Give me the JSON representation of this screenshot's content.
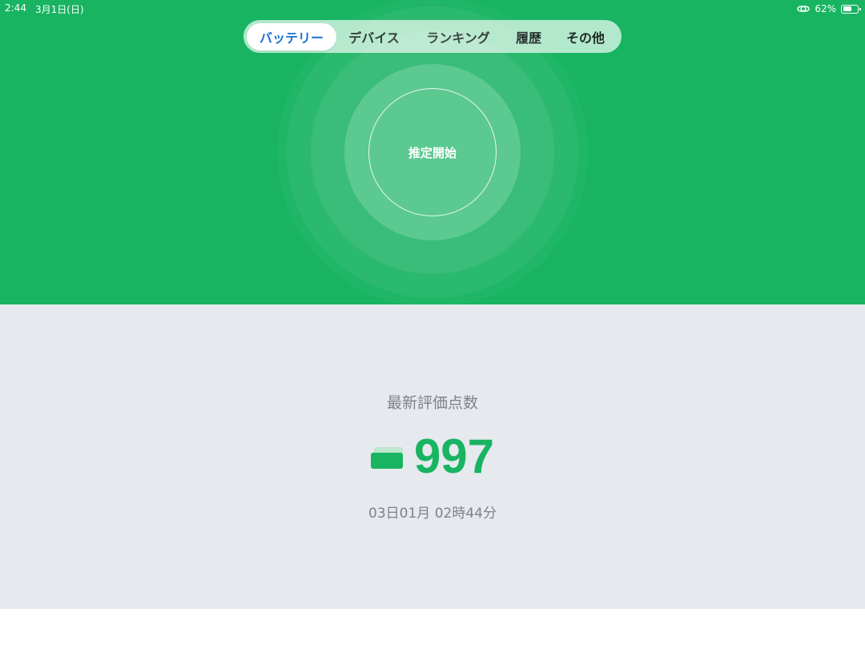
{
  "status_bar": {
    "time": "2:44",
    "date": "3月1日(日)",
    "battery_percent": "62%",
    "battery_level": 0.62
  },
  "tabs": [
    {
      "label": "バッテリー",
      "active": true
    },
    {
      "label": "デバイス",
      "active": false
    },
    {
      "label": "ランキング",
      "active": false
    },
    {
      "label": "履歴",
      "active": false
    },
    {
      "label": "その他",
      "active": false
    }
  ],
  "hero": {
    "start_label": "推定開始"
  },
  "score": {
    "label": "最新評価点数",
    "value": "997",
    "timestamp": "03日01月 02時44分"
  },
  "colors": {
    "brand_green": "#18b462",
    "active_tab_text": "#1c6fd1",
    "bottom_bg": "#e6e9ed"
  },
  "icons": {
    "status_link": "link-icon",
    "status_battery": "battery-icon",
    "score_battery": "battery-icon"
  }
}
